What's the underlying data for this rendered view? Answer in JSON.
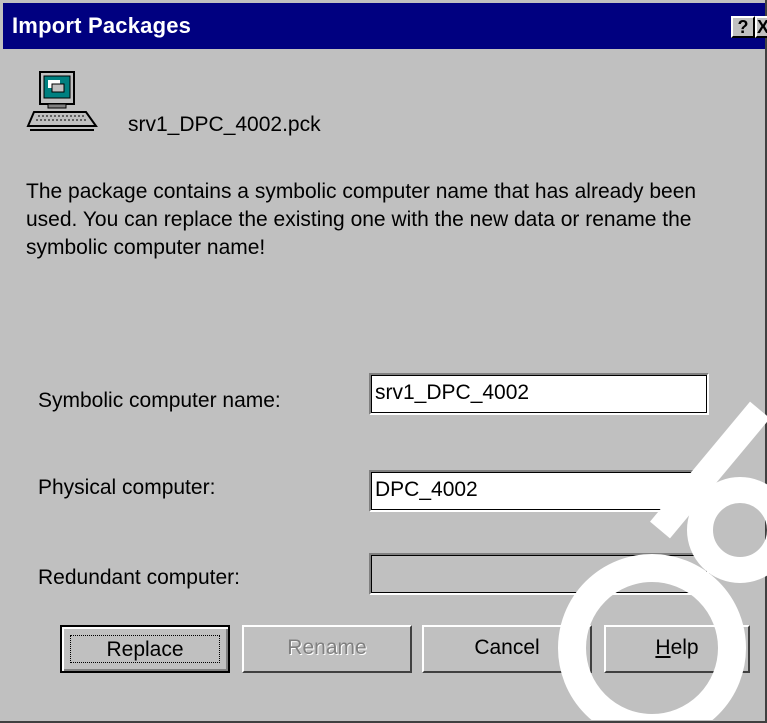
{
  "window": {
    "title": "Import Packages",
    "help_label": "?",
    "close_label": "X"
  },
  "package": {
    "filename": "srv1_DPC_4002.pck"
  },
  "message": "The package contains a symbolic computer name that has already been used. You can replace the existing one with the new data or rename the symbolic computer name!",
  "fields": {
    "symbolic_label": "Symbolic computer name:",
    "symbolic_value": "srv1_DPC_4002",
    "physical_label": "Physical computer:",
    "physical_value": "DPC_4002",
    "redundant_label": "Redundant computer:",
    "redundant_value": ""
  },
  "buttons": {
    "replace": "Replace",
    "rename": "Rename",
    "cancel": "Cancel",
    "help_mnemonic": "H",
    "help_rest": "elp"
  },
  "colors": {
    "titlebar": "#000080",
    "dialog_bg": "#c0c0c0"
  }
}
